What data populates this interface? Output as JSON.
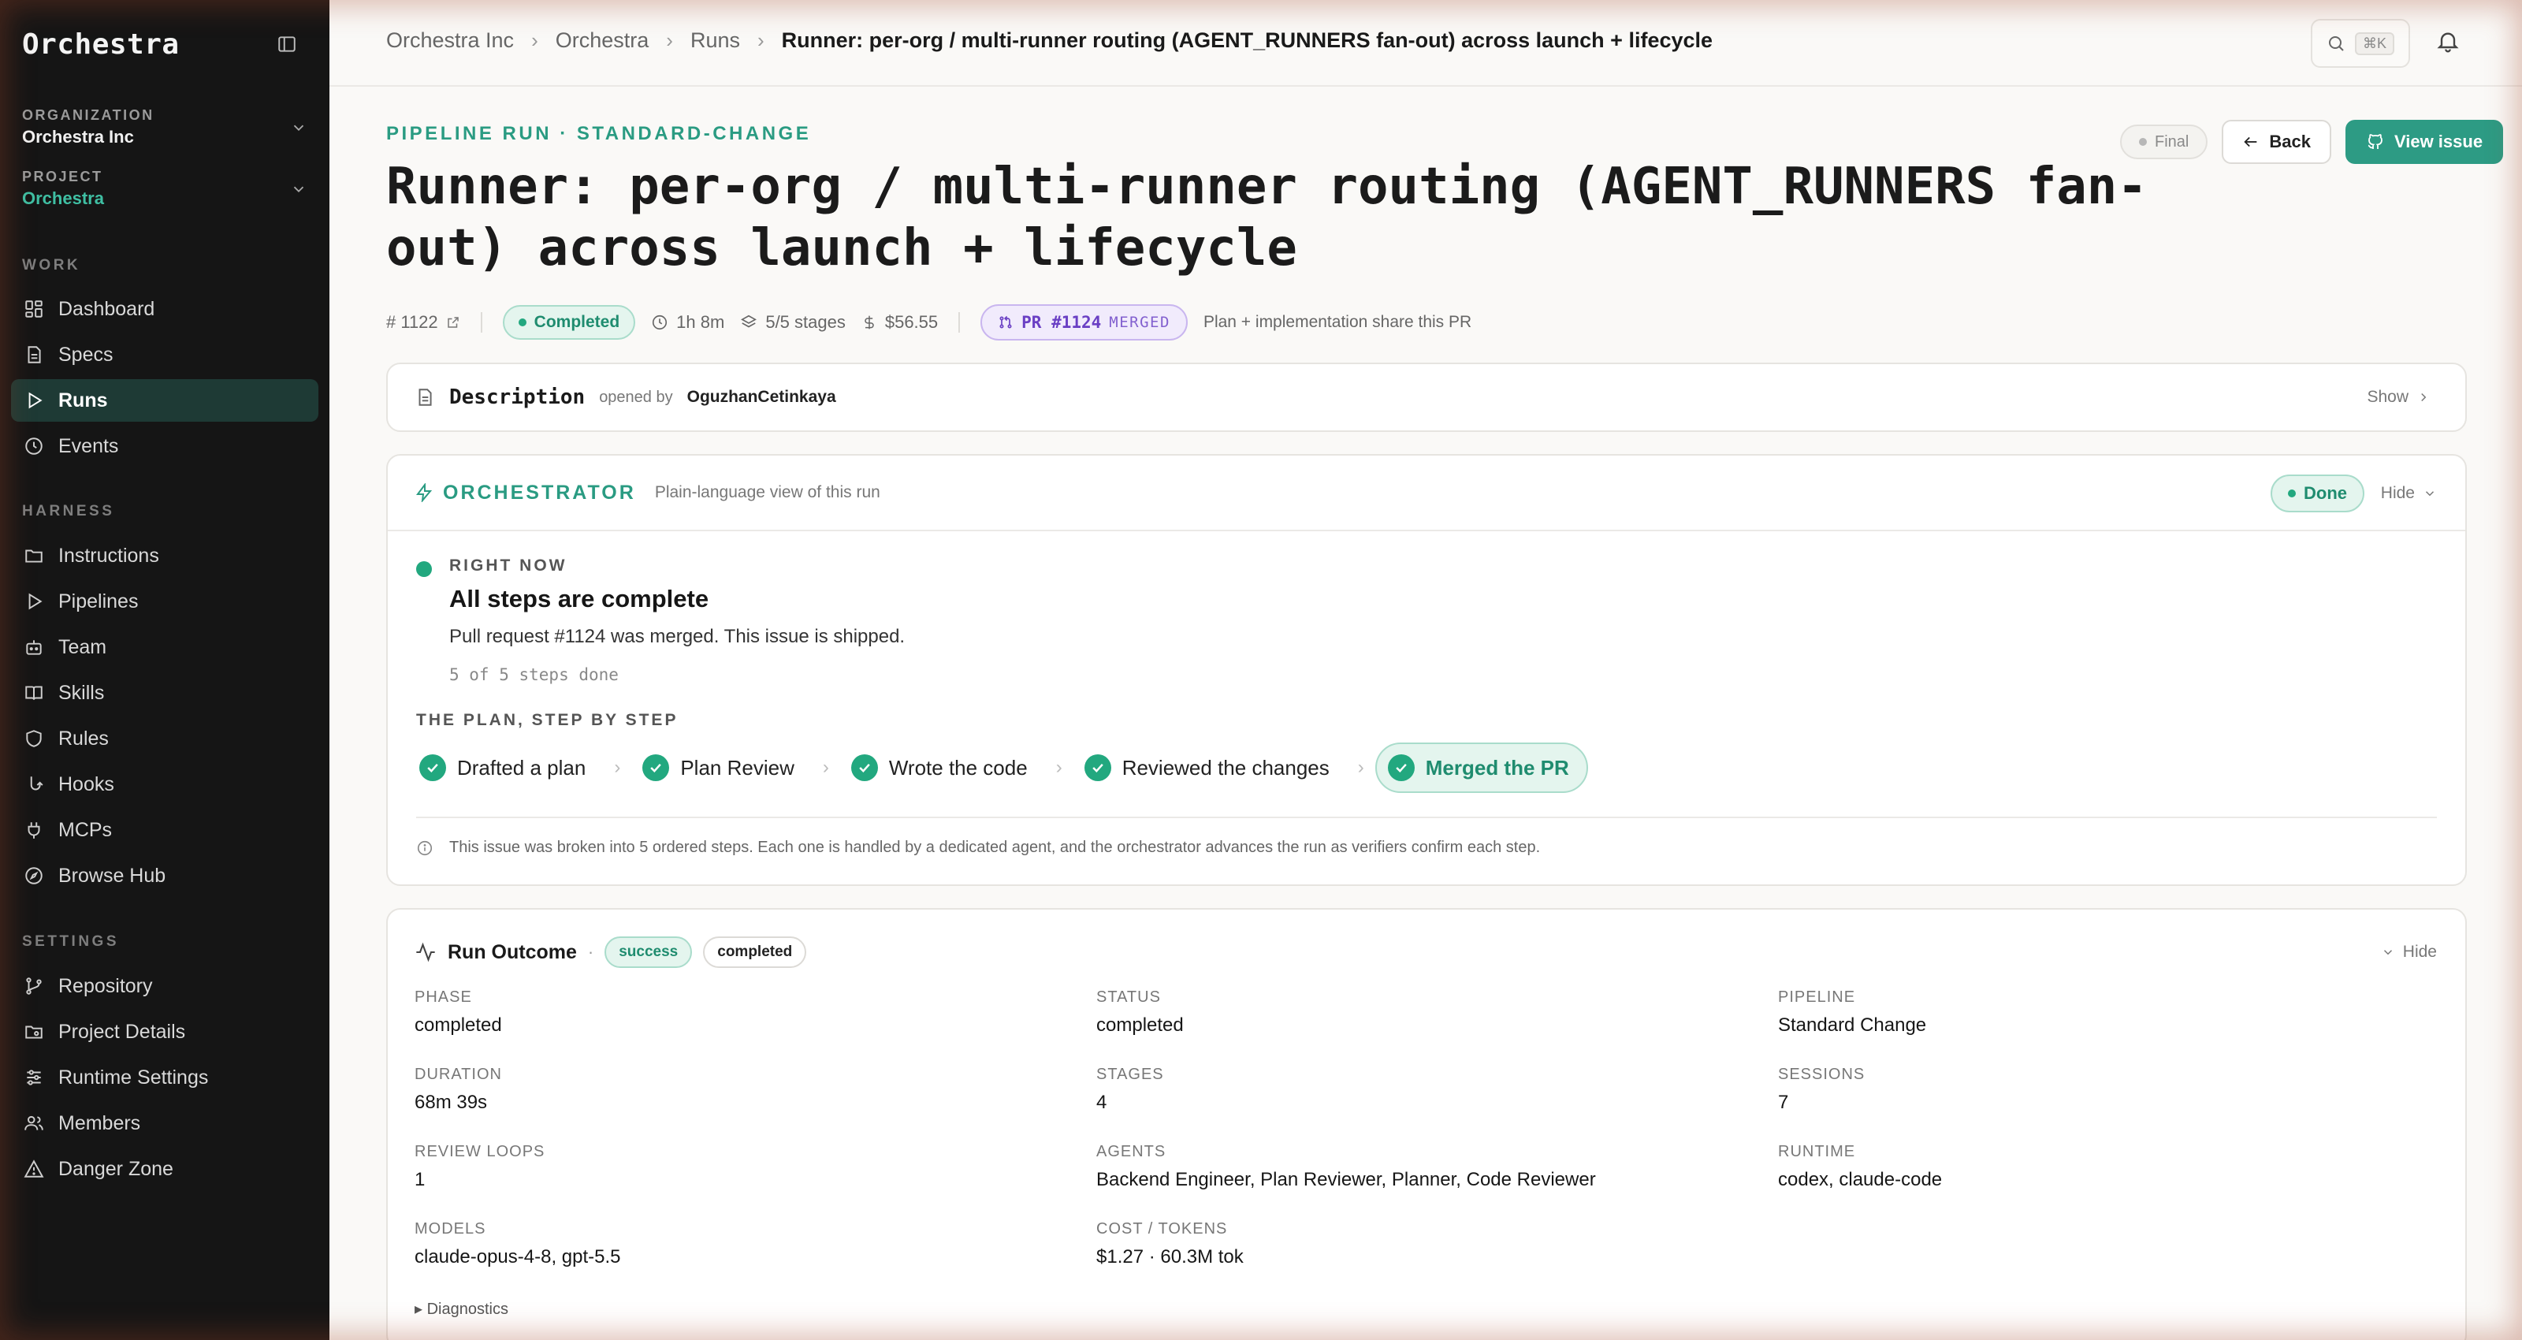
{
  "sidebar": {
    "brand": "Orchestra",
    "organization": {
      "label": "ORGANIZATION",
      "value": "Orchestra Inc"
    },
    "project": {
      "label": "PROJECT",
      "value": "Orchestra"
    },
    "sections": [
      {
        "label": "WORK",
        "items": [
          "Dashboard",
          "Specs",
          "Runs",
          "Events"
        ]
      },
      {
        "label": "HARNESS",
        "items": [
          "Instructions",
          "Pipelines",
          "Team",
          "Skills",
          "Rules",
          "Hooks",
          "MCPs",
          "Browse Hub"
        ]
      },
      {
        "label": "SETTINGS",
        "items": [
          "Repository",
          "Project Details",
          "Runtime Settings",
          "Members",
          "Danger Zone"
        ]
      }
    ],
    "active_item": "Runs"
  },
  "topbar": {
    "breadcrumbs": [
      "Orchestra Inc",
      "Orchestra",
      "Runs",
      "Runner: per-org / multi-runner routing (AGENT_RUNNERS fan-out) across launch + lifecycle"
    ],
    "shortcut": "⌘K"
  },
  "header": {
    "eyebrow": "PIPELINE RUN · STANDARD-CHANGE",
    "title": "Runner: per-org / multi-runner routing (AGENT_RUNNERS fan-out) across launch + lifecycle",
    "final_label": "Final",
    "back_label": "Back",
    "view_issue_label": "View issue"
  },
  "meta": {
    "issue_number": "# 1122",
    "status": "Completed",
    "duration": "1h 8m",
    "stages": "5/5 stages",
    "cost": "$56.55",
    "pr_label": "PR #1124",
    "pr_state": "MERGED",
    "pr_note": "Plan + implementation share this PR"
  },
  "description": {
    "title": "Description",
    "opened_by_label": "opened by",
    "author": "OguzhanCetinkaya",
    "show_label": "Show"
  },
  "orchestrator": {
    "title": "ORCHESTRATOR",
    "subtitle": "Plain-language view of this run",
    "status": "Done",
    "hide_label": "Hide",
    "now_label": "RIGHT NOW",
    "now_title": "All steps are complete",
    "now_desc": "Pull request #1124 was merged. This issue is shipped.",
    "steps_done": "5 of 5 steps done",
    "plan_label": "THE PLAN, STEP BY STEP",
    "steps": [
      "Drafted a plan",
      "Plan Review",
      "Wrote the code",
      "Reviewed the changes",
      "Merged the PR"
    ],
    "note": "This issue was broken into 5 ordered steps. Each one is handled by a dedicated agent, and the orchestrator advances the run as verifiers confirm each step."
  },
  "outcome": {
    "title": "Run Outcome",
    "tag_success": "success",
    "tag_completed": "completed",
    "hide_label": "Hide",
    "fields": {
      "phase": {
        "k": "PHASE",
        "v": "completed"
      },
      "status": {
        "k": "STATUS",
        "v": "completed"
      },
      "pipeline": {
        "k": "PIPELINE",
        "v": "Standard Change"
      },
      "duration": {
        "k": "DURATION",
        "v": "68m 39s"
      },
      "stages": {
        "k": "STAGES",
        "v": "4"
      },
      "sessions": {
        "k": "SESSIONS",
        "v": "7"
      },
      "review_loops": {
        "k": "REVIEW LOOPS",
        "v": "1"
      },
      "agents": {
        "k": "AGENTS",
        "v": "Backend Engineer, Plan Reviewer, Planner, Code Reviewer"
      },
      "runtime": {
        "k": "RUNTIME",
        "v": "codex, claude-code"
      },
      "models": {
        "k": "MODELS",
        "v": "claude-opus-4-8, gpt-5.5"
      },
      "cost_tokens": {
        "k": "COST / TOKENS",
        "v": "$1.27 · 60.3M tok"
      }
    },
    "diagnostics_label": "▸ Diagnostics"
  }
}
